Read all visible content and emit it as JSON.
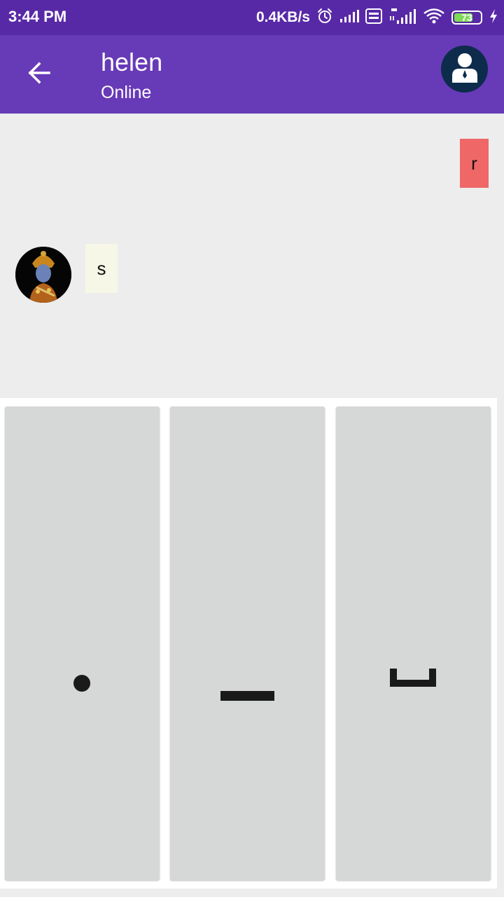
{
  "status_bar": {
    "time": "3:44 PM",
    "net_speed": "0.4KB/s",
    "battery_level": "73",
    "battery_fraction": 0.73,
    "icons": [
      "alarm-icon",
      "signal-icon",
      "volte-icon",
      "signal-4g-icon",
      "wifi-icon",
      "battery-icon",
      "charging-icon"
    ]
  },
  "header": {
    "back_icon": "arrow-back-icon",
    "name": "helen",
    "status": "Online",
    "profile_icon": "user-icon"
  },
  "messages": [
    {
      "direction": "outgoing",
      "text": "r"
    },
    {
      "direction": "incoming",
      "text": "s",
      "avatar_icon": "contact-avatar"
    }
  ],
  "keyboard": {
    "keys": [
      {
        "name": "dot",
        "icon": "dot-icon"
      },
      {
        "name": "dash",
        "icon": "dash-icon"
      },
      {
        "name": "space",
        "icon": "space-icon"
      }
    ]
  },
  "colors": {
    "status_bar": "#5829a6",
    "app_bar": "#673ab7",
    "chat_background": "#ededed",
    "outgoing_bubble": "#ef6767",
    "incoming_bubble": "#f6f7e6",
    "key_background": "#d6d8d8",
    "profile_background": "#0d2c4b"
  }
}
